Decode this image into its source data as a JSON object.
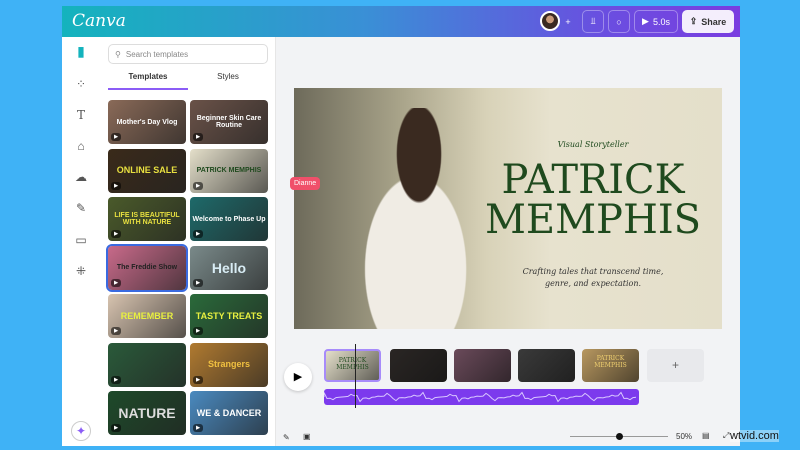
{
  "header": {
    "logo": "Canva",
    "duration": "5.0s",
    "share": "Share"
  },
  "rail": {
    "icons": [
      "design-icon",
      "elements-icon",
      "text-icon",
      "brand-icon",
      "uploads-icon",
      "draw-icon",
      "projects-icon",
      "apps-icon",
      "magic-icon"
    ]
  },
  "panel": {
    "search_placeholder": "Search templates",
    "tabs": [
      "Templates",
      "Styles"
    ],
    "templates": [
      {
        "text": "Mother's Day Vlog",
        "bg": "#8a6a58",
        "fg": "#fff"
      },
      {
        "text": "Beginner Skin Care Routine",
        "bg": "#6a5248",
        "fg": "#fff"
      },
      {
        "text": "ONLINE SALE",
        "bg": "#3a2a1a",
        "fg": "#e8e040"
      },
      {
        "text": "PATRICK MEMPHIS",
        "bg": "#e4dfca",
        "fg": "#1f4a1e"
      },
      {
        "text": "LIFE IS BEAUTIFUL WITH NATURE",
        "bg": "#4a5a2a",
        "fg": "#e8e040"
      },
      {
        "text": "Welcome to Phase Up",
        "bg": "#1e6a6a",
        "fg": "#fff"
      },
      {
        "text": "The Freddie Show",
        "bg": "#c86a8a",
        "fg": "#222"
      },
      {
        "text": "Hello",
        "bg": "#7a8a8a",
        "fg": "#d8ecf4"
      },
      {
        "text": "REMEMBER",
        "bg": "#d8c4b0",
        "fg": "#e8f040"
      },
      {
        "text": "TASTY TREATS",
        "bg": "#2a6a3a",
        "fg": "#e8f040"
      },
      {
        "text": "",
        "bg": "#2a5a3a",
        "fg": "#e8a0a0"
      },
      {
        "text": "Strangers",
        "bg": "#b07a30",
        "fg": "#f0c040"
      },
      {
        "text": "NATURE",
        "bg": "#1e4a2a",
        "fg": "#ddd"
      },
      {
        "text": "WE & DANCER",
        "bg": "#4a8ac0",
        "fg": "#fff"
      }
    ],
    "cursor_label": "Dianne"
  },
  "design": {
    "subtitle": "Visual Storyteller",
    "title_line1": "PATRICK",
    "title_line2": "MEMPHIS",
    "tagline_line1": "Crafting tales that transcend time,",
    "tagline_line2": "genre, and expectation."
  },
  "timeline": {
    "clips": [
      {
        "label": "PATRICK MEMPHIS",
        "bg": "#e4dfca"
      },
      {
        "label": "",
        "bg": "#2a2624"
      },
      {
        "label": "",
        "bg": "#6a4a5a"
      },
      {
        "label": "",
        "bg": "#3a3a3a"
      },
      {
        "label": "PATRICK MEMPHIS",
        "bg": "#b89860"
      }
    ],
    "add": "+"
  },
  "footer": {
    "zoom": "50%",
    "zoom_level": 50
  },
  "watermark": "wtvid.com",
  "colors": {
    "accent": "#8b5cf6",
    "audio": "#7c3aed",
    "page_bg": "#3fb2f6"
  }
}
